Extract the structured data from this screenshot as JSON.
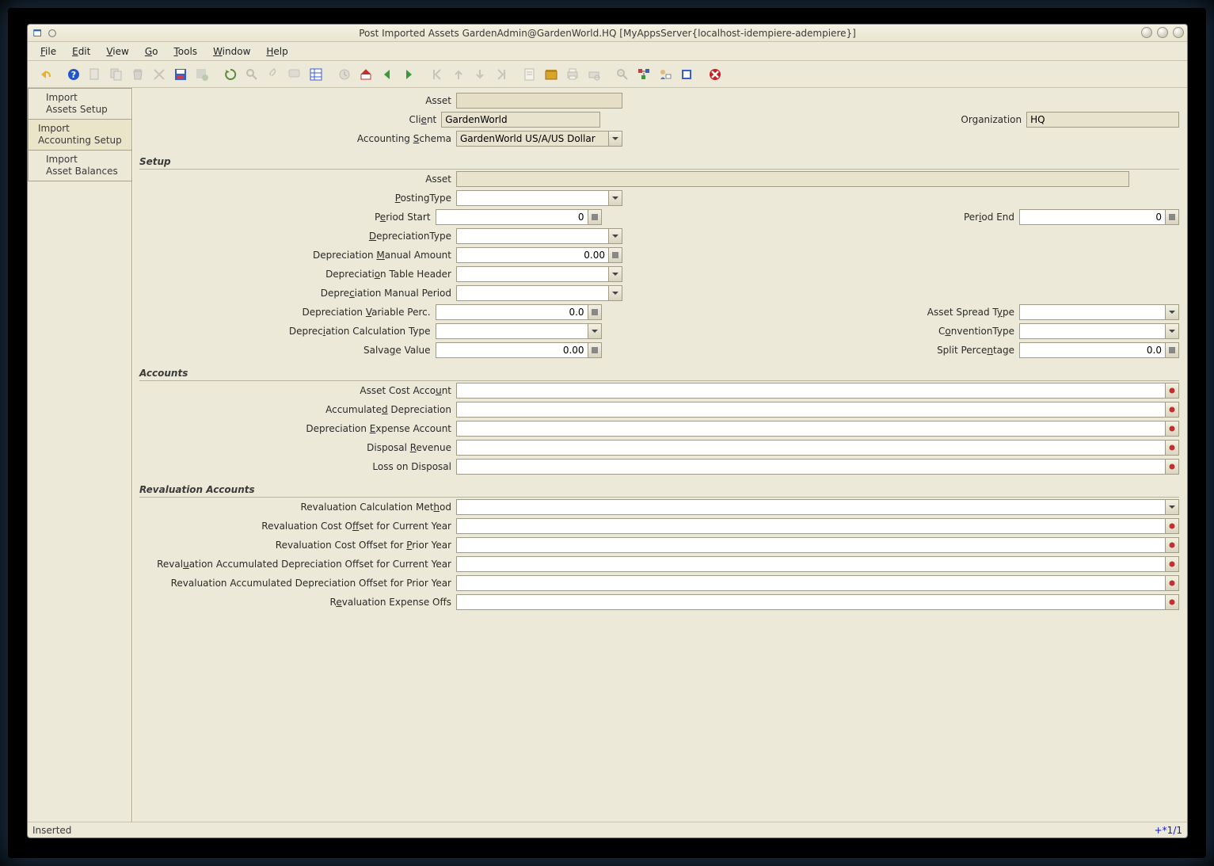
{
  "window_title": "Post Imported Assets  GardenAdmin@GardenWorld.HQ [MyAppsServer{localhost-idempiere-adempiere}]",
  "menus": [
    "File",
    "Edit",
    "View",
    "Go",
    "Tools",
    "Window",
    "Help"
  ],
  "menu_underlines": [
    0,
    0,
    0,
    0,
    0,
    0,
    0
  ],
  "tabs": [
    {
      "line1": "Import",
      "line2": "Assets Setup",
      "indent": true
    },
    {
      "line1": "Import",
      "line2": "Accounting Setup",
      "indent": false
    },
    {
      "line1": "Import",
      "line2": "Asset Balances",
      "indent": true
    }
  ],
  "active_tab": 1,
  "sections": {
    "setup": "Setup",
    "accounts": "Accounts",
    "reval": "Revaluation Accounts"
  },
  "labels": {
    "asset": "Asset",
    "client": "Client",
    "organization": "Organization",
    "acct_schema": "Accounting Schema",
    "asset2": "Asset",
    "posting": "PostingType",
    "period_start": "Period Start",
    "period_end": "Period End",
    "dep_type": "DepreciationType",
    "dep_man_amt": "Depreciation Manual Amount",
    "dep_tbl_hdr": "Depreciation Table Header",
    "dep_man_per": "Depreciation Manual Period",
    "dep_var_perc": "Depreciation Variable Perc.",
    "spread": "Asset Spread Type",
    "dep_calc": "Depreciation Calculation Type",
    "conv": "ConventionType",
    "salvage": "Salvage Value",
    "split": "Split Percentage",
    "cost_acct": "Asset Cost Account",
    "acc_dep": "Accumulated Depreciation",
    "dep_exp": "Depreciation Expense Account",
    "disp_rev": "Disposal Revenue",
    "loss_disp": "Loss on Disposal",
    "reval_calc": "Revaluation Calculation Method",
    "reval_cost_cur": "Revaluation Cost Offset for Current Year",
    "reval_cost_prior": "Revaluation Cost Offset for Prior Year",
    "reval_acc_cur": "Revaluation Accumulated Depreciation Offset for Current Year",
    "reval_acc_prior": "Revaluation Accumulated Depreciation Offset for Prior Year",
    "reval_exp": "Revaluation Expense Offs"
  },
  "values": {
    "client": "GardenWorld",
    "organization": "HQ",
    "acct_schema": "GardenWorld US/A/US Dollar",
    "period_start": "0",
    "period_end": "0",
    "dep_man_amt": "0.00",
    "dep_var_perc": "0.0",
    "salvage": "0.00",
    "split": "0.0"
  },
  "status_left": "Inserted",
  "status_right": "+*1/1",
  "u": {
    "client": "Cli<u>e</u>nt",
    "acct_schema": "Accounting <u>S</u>chema",
    "posting": "<u>P</u>ostingType",
    "period_start": "P<u>e</u>riod Start",
    "period_end": "Per<u>i</u>od End",
    "dep_type": "<u>D</u>epreciationType",
    "dep_man_amt": "Depreciation <u>M</u>anual Amount",
    "dep_tbl_hdr": "Depreciati<u>o</u>n Table Header",
    "dep_man_per": "Depre<u>c</u>iation Manual Period",
    "dep_var_perc": "Depreciation <u>V</u>ariable Perc.",
    "spread": "Asset Spread T<u>y</u>pe",
    "dep_calc": "Deprec<u>i</u>ation Calculation Type",
    "conv": "C<u>o</u>nventionType",
    "salvage": "Salva<u>g</u>e Value",
    "split": "Split Perce<u>n</u>tage",
    "cost_acct": "Asset Cost Acco<u>u</u>nt",
    "acc_dep": "Accumulate<u>d</u> Depreciation",
    "dep_exp": "Depreciation <u>E</u>xpense Account",
    "disp_rev": "Disposal <u>R</u>evenue",
    "loss_disp": "Loss on Disposal",
    "reval_calc": "Revaluation Calculation Met<u>h</u>od",
    "reval_cost_cur": "Revaluation Cost O<u>f</u>fset for Current Year",
    "reval_cost_prior": "Revaluation Cost Offset for <u>P</u>rior Year",
    "reval_acc_cur": "Reval<u>u</u>ation Accumulated Depreciation Offset for Current Year",
    "reval_acc_prior": "Revaluation Accumulated Depreciation Offset for Prior Year",
    "reval_exp": "R<u>e</u>valuation Expense Offs"
  }
}
